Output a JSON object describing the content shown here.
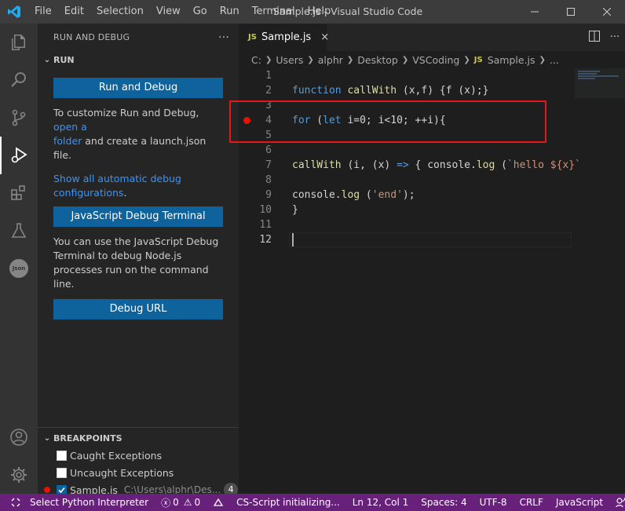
{
  "titlebar": {
    "menu": [
      "File",
      "Edit",
      "Selection",
      "View",
      "Go",
      "Run",
      "Terminal",
      "Help"
    ],
    "title": "Sample.js - Visual Studio Code"
  },
  "activity": {
    "json_label": "Json"
  },
  "sidebar": {
    "header": "RUN AND DEBUG",
    "more": "···",
    "run_section": "RUN",
    "run_button": "Run and Debug",
    "customize_text_1": "To customize Run and Debug, ",
    "customize_link_1": "open a",
    "customize_link_2": "folder",
    "customize_text_2": " and create a launch.json file.",
    "show_link_1": "Show all automatic debug",
    "show_link_2": "configurations",
    "show_suffix": ".",
    "js_debug_button": "JavaScript Debug Terminal",
    "js_debug_text": "You can use the JavaScript Debug Terminal to debug Node.js processes run on the command line.",
    "debug_url_button": "Debug URL",
    "breakpoints_section": "BREAKPOINTS",
    "breakpoints": [
      {
        "label": "Caught Exceptions"
      },
      {
        "label": "Uncaught Exceptions"
      },
      {
        "label": "Sample.js",
        "path": "C:\\Users\\alphr\\Des...",
        "line": "4"
      }
    ]
  },
  "editor": {
    "tab_badge": "JS",
    "tab_label": "Sample.js",
    "tab_close": "×",
    "breadcrumb": [
      "C:",
      "Users",
      "alphr",
      "Desktop",
      "VSCoding"
    ],
    "breadcrumb_file": "Sample.js",
    "breadcrumb_more": "...",
    "line_numbers": [
      "1",
      "2",
      "3",
      "4",
      "5",
      "6",
      "7",
      "8",
      "9",
      "10",
      "11",
      "12"
    ],
    "code": {
      "l2_kw": "function",
      "l2_fn": "callWith",
      "l2_rest": " (x,f) {f (x);}",
      "l4_kw1": "for",
      "l4_p1": " (",
      "l4_kw2": "let",
      "l4_p2": " i=0; i<10; ++i){",
      "l7_fn": "callWith",
      "l7_p1": " (i, (x) ",
      "l7_arrow": "=>",
      "l7_p2": " { console.",
      "l7_fn2": "log",
      "l7_p3": " (",
      "l7_str": "`hello ${x}`",
      "l9_p1": "console.",
      "l9_fn": "log",
      "l9_p2": " (",
      "l9_str": "'end'",
      "l9_p3": ");",
      "l10": "}"
    }
  },
  "statusbar": {
    "python": "Select Python Interpreter",
    "errors": "0",
    "warnings": "0",
    "cs_script": "CS-Script initializing...",
    "position": "Ln 12, Col 1",
    "spaces": "Spaces: 4",
    "encoding": "UTF-8",
    "eol": "CRLF",
    "language": "JavaScript"
  },
  "colors": {
    "accent": "#0e639c",
    "statusbar": "#68217a",
    "breakpoint": "#e51400",
    "highlight": "#e8161b"
  }
}
